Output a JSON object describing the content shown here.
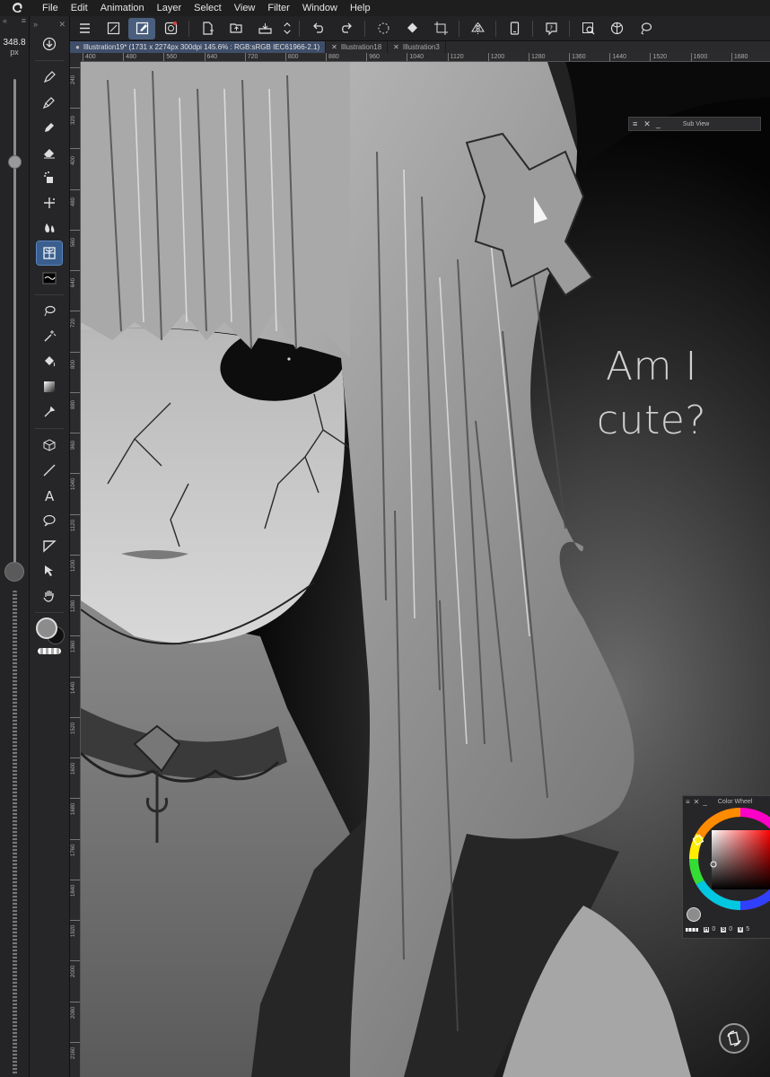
{
  "menubar": {
    "items": [
      "File",
      "Edit",
      "Animation",
      "Layer",
      "Select",
      "View",
      "Filter",
      "Window",
      "Help"
    ]
  },
  "brush_size": {
    "value": "348.8",
    "unit": "px",
    "level": 0.45
  },
  "tabs": [
    {
      "label": "Illustration19* (1731 x 2274px 300dpi 145.6% : RGB:sRGB IEC61966-2.1)",
      "active": true
    },
    {
      "label": "Illustration18",
      "active": false
    },
    {
      "label": "Illustration3",
      "active": false
    }
  ],
  "ruler": {
    "x_ticks": [
      "400",
      "480",
      "560",
      "640",
      "720",
      "800",
      "880",
      "960",
      "1040",
      "1120",
      "1200",
      "1280",
      "1360",
      "1440",
      "1520",
      "1600",
      "1680"
    ],
    "y_ticks": [
      "240",
      "320",
      "400",
      "480",
      "560",
      "640",
      "720",
      "800",
      "880",
      "960",
      "1040",
      "1120",
      "1200",
      "1280",
      "1360",
      "1440",
      "1520",
      "1600",
      "1680",
      "1760",
      "1840",
      "1920",
      "2000",
      "2080",
      "2160"
    ]
  },
  "canvas": {
    "caption_line1": "Am I",
    "caption_line2": "cute?"
  },
  "sub_view": {
    "title": "Sub View"
  },
  "color_wheel": {
    "title": "Color Wheel",
    "h_label": "H",
    "h_value": "0",
    "s_label": "S",
    "s_value": "0",
    "v_label": "V",
    "v_value": "5"
  },
  "colors": {
    "accent": "#3a5f8e",
    "main_color": "#8c8c8c",
    "canvas_bg": "#000000"
  },
  "icons": {
    "tools": [
      "download-icon",
      "pen-icon",
      "pencil-icon",
      "marker-icon",
      "eraser-icon",
      "airbrush-icon",
      "sparkle-icon",
      "blend-icon",
      "figure-ruler-icon",
      "brush-preview-icon",
      "lasso-icon",
      "magic-wand-icon",
      "fill-icon",
      "gradient-icon",
      "eyedropper-icon",
      "3d-cube-icon",
      "line-icon",
      "text-icon",
      "balloon-icon",
      "frame-icon",
      "object-select-icon",
      "hand-icon"
    ]
  }
}
